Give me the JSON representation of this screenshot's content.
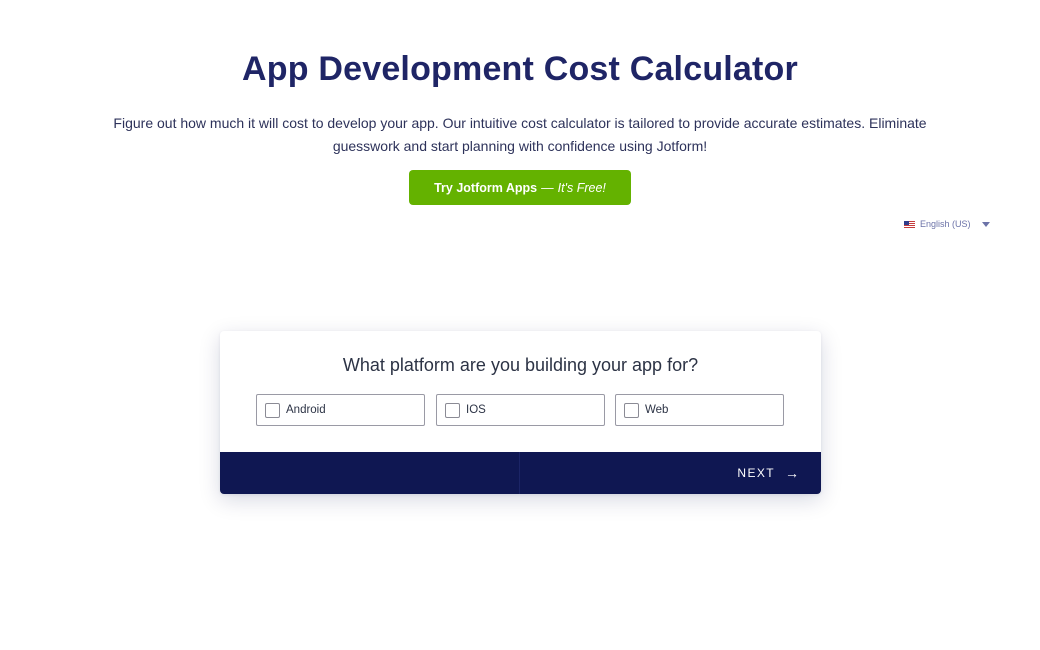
{
  "header": {
    "title": "App Development Cost Calculator",
    "description": "Figure out how much it will cost to develop your app. Our intuitive cost calculator is tailored to provide accurate estimates. Eliminate guesswork and start planning with confidence using Jotform!"
  },
  "cta": {
    "main_label": "Try Jotform Apps",
    "separator": "—",
    "sub_label": "It's Free!",
    "color": "#64b200"
  },
  "language": {
    "flag_icon": "us-flag-icon",
    "selected": "English (US)",
    "caret_icon": "caret-down-icon"
  },
  "form": {
    "question": "What platform are you building your app for?",
    "options": [
      {
        "label": "Android",
        "checked": false
      },
      {
        "label": "IOS",
        "checked": false
      },
      {
        "label": "Web",
        "checked": false
      }
    ],
    "footer_color": "#0f1752",
    "next_label": "NEXT",
    "next_icon": "→"
  }
}
